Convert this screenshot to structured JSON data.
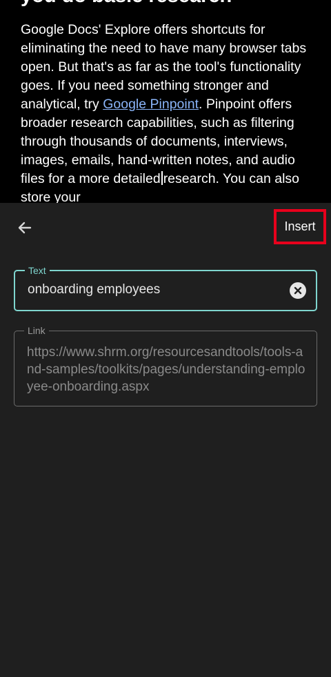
{
  "document": {
    "heading": "you do basic research",
    "para_before_link": "Google Docs' Explore offers shortcuts for eliminating the need to have many browser tabs open. But that's as far as the tool's functionality goes. If you need something stronger and analytical, try ",
    "link_text": "Google Pinpoint",
    "para_after_link": ". Pinpoint offers broader research capabilities, such as filtering through thousands of documents, interviews, images, emails, hand-written notes, and audio files for a more detailed",
    "para_after_caret": "research. You can also store your"
  },
  "dialog": {
    "back_icon": "arrow-left-icon",
    "insert_label": "Insert",
    "accent_color": "#7fd6cf",
    "highlight_color": "#e8001c",
    "text_field": {
      "label": "Text",
      "value": "onboarding employees",
      "clear_icon": "clear-icon"
    },
    "link_field": {
      "label": "Link",
      "value": "https://www.shrm.org/resourcesandtools/tools-and-samples/toolkits/pages/understanding-employee-onboarding.aspx"
    }
  }
}
